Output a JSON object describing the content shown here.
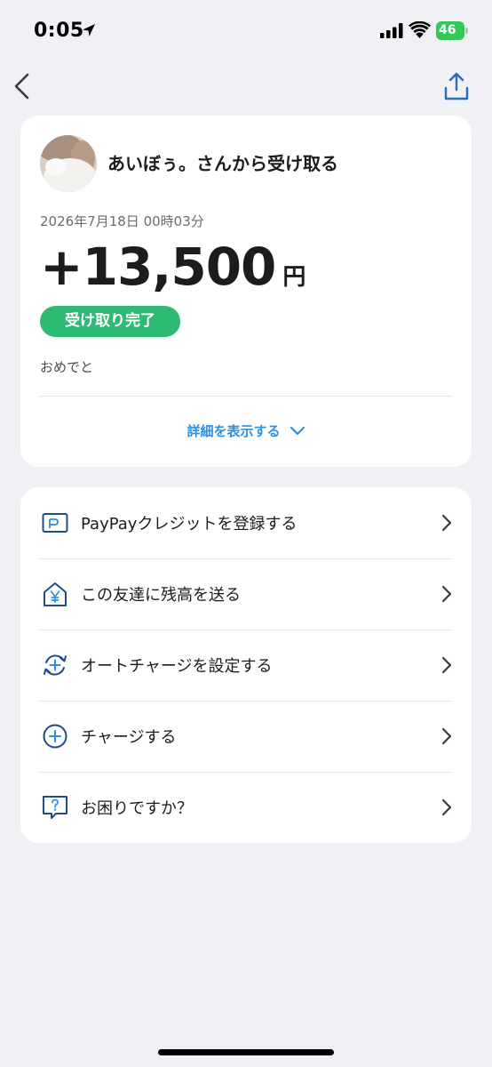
{
  "status_bar": {
    "time": "0:05",
    "battery": "46"
  },
  "transaction": {
    "title": "あいぼぅ。さんから受け取る",
    "datetime": "2026年7月18日 00時03分",
    "amount": "+13,500",
    "currency": "円",
    "status": "受け取り完了",
    "message": "おめでと",
    "details_label": "詳細を表示する"
  },
  "menu": {
    "items": [
      {
        "label": "PayPayクレジットを登録する",
        "icon": "credit-card-icon"
      },
      {
        "label": "この友達に残高を送る",
        "icon": "yen-house-icon"
      },
      {
        "label": "オートチャージを設定する",
        "icon": "auto-charge-icon"
      },
      {
        "label": "チャージする",
        "icon": "plus-circle-icon"
      },
      {
        "label": "お困りですか？",
        "icon": "help-chat-icon"
      }
    ]
  },
  "colors": {
    "accent_blue": "#2f8fe0",
    "success_green": "#2dbb73",
    "icon_navy": "#1f4b8f",
    "background": "#f0f1f5"
  }
}
